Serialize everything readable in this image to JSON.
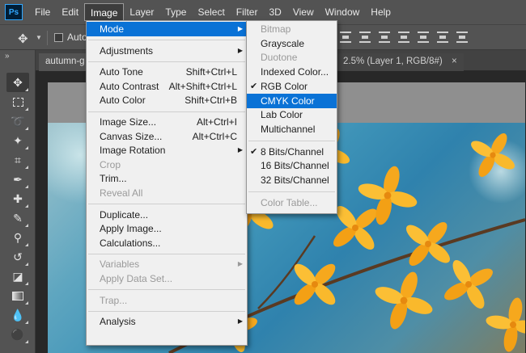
{
  "app": {
    "logo": "Ps"
  },
  "menubar": [
    "File",
    "Edit",
    "Image",
    "Layer",
    "Type",
    "Select",
    "Filter",
    "3D",
    "View",
    "Window",
    "Help"
  ],
  "options_bar": {
    "auto_select_label": "Auto"
  },
  "tabs": [
    {
      "label": "autumn-g",
      "active": true
    },
    {
      "label": "2.5% (Layer 1, RGB/8#)",
      "close": "×"
    }
  ],
  "image_menu": {
    "items": [
      {
        "label": "Mode",
        "shortcut": "",
        "submenu": true,
        "highlighted": true
      },
      {
        "sep": true
      },
      {
        "label": "Adjustments",
        "shortcut": "",
        "submenu": true
      },
      {
        "sep": true
      },
      {
        "label": "Auto Tone",
        "shortcut": "Shift+Ctrl+L"
      },
      {
        "label": "Auto Contrast",
        "shortcut": "Alt+Shift+Ctrl+L"
      },
      {
        "label": "Auto Color",
        "shortcut": "Shift+Ctrl+B"
      },
      {
        "sep": true
      },
      {
        "label": "Image Size...",
        "shortcut": "Alt+Ctrl+I"
      },
      {
        "label": "Canvas Size...",
        "shortcut": "Alt+Ctrl+C"
      },
      {
        "label": "Image Rotation",
        "shortcut": "",
        "submenu": true
      },
      {
        "label": "Crop",
        "shortcut": "",
        "disabled": true
      },
      {
        "label": "Trim...",
        "shortcut": ""
      },
      {
        "label": "Reveal All",
        "shortcut": "",
        "disabled": true
      },
      {
        "sep": true
      },
      {
        "label": "Duplicate...",
        "shortcut": ""
      },
      {
        "label": "Apply Image...",
        "shortcut": ""
      },
      {
        "label": "Calculations...",
        "shortcut": ""
      },
      {
        "sep": true
      },
      {
        "label": "Variables",
        "shortcut": "",
        "submenu": true,
        "disabled": true
      },
      {
        "label": "Apply Data Set...",
        "shortcut": "",
        "disabled": true
      },
      {
        "sep": true
      },
      {
        "label": "Trap...",
        "shortcut": "",
        "disabled": true
      },
      {
        "sep": true
      },
      {
        "label": "Analysis",
        "shortcut": "",
        "submenu": true
      }
    ]
  },
  "mode_submenu": {
    "items": [
      {
        "label": "Bitmap",
        "disabled": true
      },
      {
        "label": "Grayscale"
      },
      {
        "label": "Duotone",
        "disabled": true
      },
      {
        "label": "Indexed Color..."
      },
      {
        "label": "RGB Color",
        "checked": true
      },
      {
        "label": "CMYK Color",
        "highlighted": true
      },
      {
        "label": "Lab Color"
      },
      {
        "label": "Multichannel"
      },
      {
        "sep": true
      },
      {
        "label": "8 Bits/Channel",
        "checked": true
      },
      {
        "label": "16 Bits/Channel"
      },
      {
        "label": "32 Bits/Channel"
      },
      {
        "sep": true
      },
      {
        "label": "Color Table...",
        "disabled": true
      }
    ]
  },
  "tools": [
    "move-tool-icon",
    "marquee-tool-icon",
    "lasso-tool-icon",
    "magic-wand-icon",
    "crop-tool-icon",
    "eyedropper-icon",
    "healing-brush-icon",
    "brush-tool-icon",
    "clone-stamp-icon",
    "history-brush-icon",
    "eraser-icon",
    "gradient-tool-icon",
    "blur-tool-icon"
  ],
  "colors": {
    "menu_highlight": "#0a72d6",
    "menu_bg": "#f0f0f0",
    "chrome": "#535353",
    "petal": "#f5a51c"
  }
}
